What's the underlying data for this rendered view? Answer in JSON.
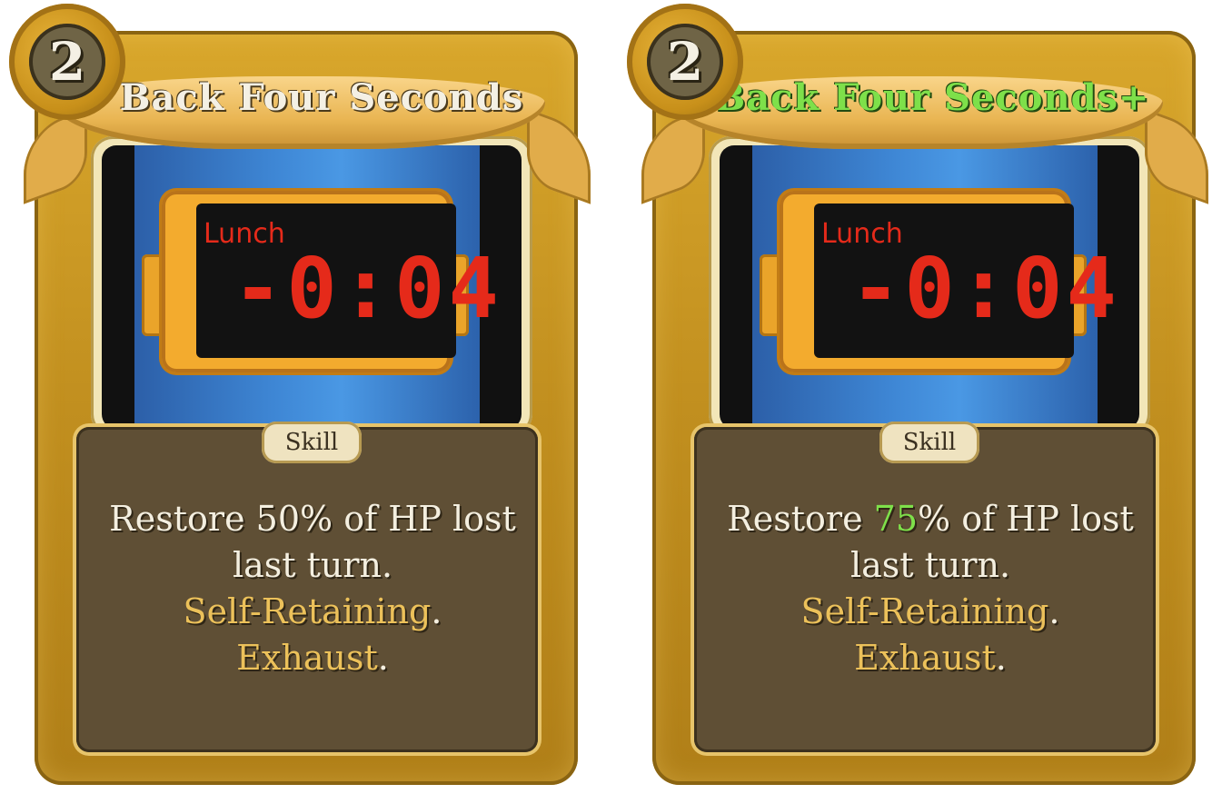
{
  "cards": [
    {
      "cost": "2",
      "title": "Back Four Seconds",
      "art": {
        "label": "Lunch",
        "time": "-0:04"
      },
      "type": "Skill",
      "desc": {
        "line1_a": "Restore ",
        "line1_val": "50",
        "line1_b": "%  of HP lost",
        "line2": "last turn.",
        "kw1": "Self-Retaining",
        "kw2": "Exhaust",
        "period": "."
      }
    },
    {
      "cost": "2",
      "title": "Back Four Seconds+",
      "art": {
        "label": "Lunch",
        "time": "-0:04"
      },
      "type": "Skill",
      "desc": {
        "line1_a": "Restore ",
        "line1_val": "75",
        "line1_b": "%  of HP lost",
        "line2": "last turn.",
        "kw1": "Self-Retaining",
        "kw2": "Exhaust",
        "period": "."
      }
    }
  ],
  "colors": {
    "upgraded_title": "#7ee04a",
    "keyword": "#ecc15a",
    "clock_digits": "#e52a1a"
  }
}
